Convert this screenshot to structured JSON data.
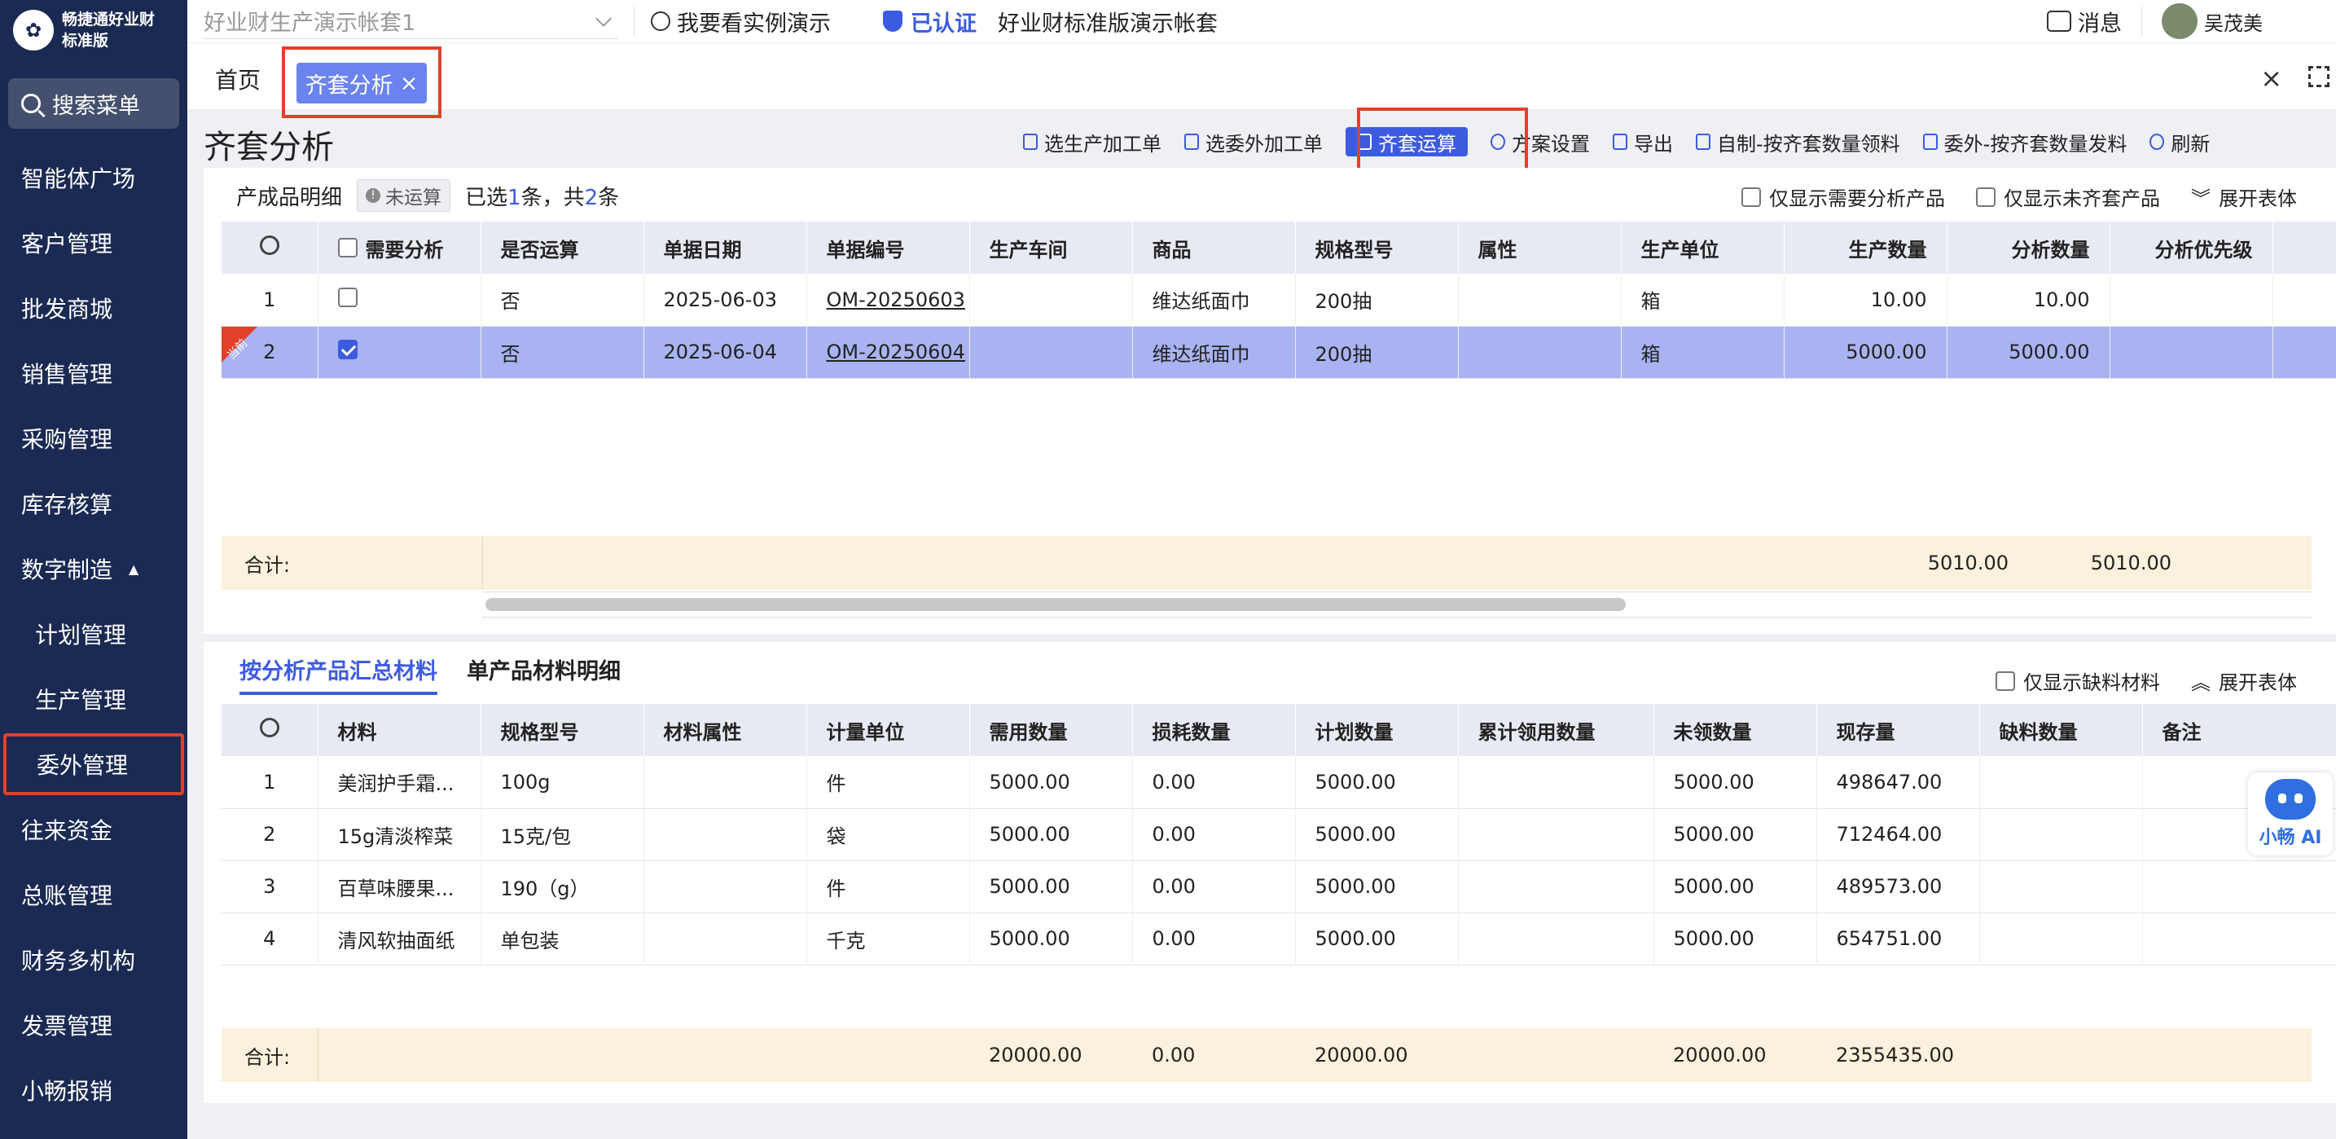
{
  "sidebar": {
    "logo_text_line1": "畅捷通好业财",
    "logo_text_line2": "标准版",
    "search_label": "搜索菜单",
    "items": [
      {
        "label": "智能体广场"
      },
      {
        "label": "客户管理"
      },
      {
        "label": "批发商城"
      },
      {
        "label": "销售管理"
      },
      {
        "label": "采购管理"
      },
      {
        "label": "库存核算"
      },
      {
        "label": "数字制造"
      },
      {
        "label": "计划管理"
      },
      {
        "label": "生产管理"
      },
      {
        "label": "委外管理"
      },
      {
        "label": "往来资金"
      },
      {
        "label": "总账管理"
      },
      {
        "label": "财务多机构"
      },
      {
        "label": "发票管理"
      },
      {
        "label": "小畅报销"
      }
    ]
  },
  "topbar": {
    "account": "好业财生产演示帐套1",
    "demo_link": "我要看实例演示",
    "verified": "已认证",
    "std_account": "好业财标准版演示帐套",
    "messages": "消息",
    "user": "吴茂美"
  },
  "tabs": {
    "home": "首页",
    "active": "齐套分析",
    "active_close": "×",
    "close_all": "×"
  },
  "page": {
    "title": "齐套分析"
  },
  "toolbar": {
    "select_prod": "选生产加工单",
    "select_outsource": "选委外加工单",
    "calc": "齐套运算",
    "scheme": "方案设置",
    "export": "导出",
    "self_issue": "自制-按齐套数量领料",
    "out_issue": "委外-按齐套数量发料",
    "refresh": "刷新"
  },
  "panel1": {
    "title": "产成品明细",
    "status_badge": "未运算",
    "status_badge_icon": "!",
    "sel_prefix": "已选",
    "sel_count": "1",
    "sel_mid": "条，共",
    "sel_total": "2",
    "sel_suffix": "条",
    "only_need": "仅显示需要分析产品",
    "only_incomplete": "仅显示未齐套产品",
    "expand": "展开表体",
    "current_tag": "当前",
    "columns": [
      "需要分析",
      "是否运算",
      "单据日期",
      "单据编号",
      "生产车间",
      "商品",
      "规格型号",
      "属性",
      "生产单位",
      "生产数量",
      "分析数量",
      "分析优先级"
    ],
    "rows": [
      {
        "idx": "1",
        "calc": "否",
        "date": "2025-06-03",
        "code": "OM-20250603",
        "workshop": "",
        "goods": "维达纸面巾",
        "spec": "200抽",
        "attr": "",
        "unit": "箱",
        "qty": "10.00",
        "aqty": "10.00",
        "prio": ""
      },
      {
        "idx": "2",
        "calc": "否",
        "date": "2025-06-04",
        "code": "OM-20250604",
        "workshop": "",
        "goods": "维达纸面巾",
        "spec": "200抽",
        "attr": "",
        "unit": "箱",
        "qty": "5000.00",
        "aqty": "5000.00",
        "prio": ""
      }
    ],
    "sum_label": "合计:",
    "sum_qty": "5010.00",
    "sum_aqty": "5010.00"
  },
  "panel2": {
    "tab_summary": "按分析产品汇总材料",
    "tab_detail": "单产品材料明细",
    "only_short": "仅显示缺料材料",
    "expand": "展开表体",
    "columns": [
      "材料",
      "规格型号",
      "材料属性",
      "计量单位",
      "需用数量",
      "损耗数量",
      "计划数量",
      "累计领用数量",
      "未领数量",
      "现存量",
      "缺料数量",
      "备注"
    ],
    "rows": [
      {
        "idx": "1",
        "mat": "美润护手霜...",
        "spec": "100g",
        "attr": "",
        "unit": "件",
        "need": "5000.00",
        "loss": "0.00",
        "plan": "5000.00",
        "cum": "",
        "unrec": "5000.00",
        "stock": "498647.00",
        "short": "",
        "note": ""
      },
      {
        "idx": "2",
        "mat": "15g清淡榨菜",
        "spec": "15克/包",
        "attr": "",
        "unit": "袋",
        "need": "5000.00",
        "loss": "0.00",
        "plan": "5000.00",
        "cum": "",
        "unrec": "5000.00",
        "stock": "712464.00",
        "short": "",
        "note": ""
      },
      {
        "idx": "3",
        "mat": "百草味腰果...",
        "spec": "190（g）",
        "attr": "",
        "unit": "件",
        "need": "5000.00",
        "loss": "0.00",
        "plan": "5000.00",
        "cum": "",
        "unrec": "5000.00",
        "stock": "489573.00",
        "short": "",
        "note": ""
      },
      {
        "idx": "4",
        "mat": "清风软抽面纸",
        "spec": "单包装",
        "attr": "",
        "unit": "千克",
        "need": "5000.00",
        "loss": "0.00",
        "plan": "5000.00",
        "cum": "",
        "unrec": "5000.00",
        "stock": "654751.00",
        "short": "",
        "note": ""
      }
    ],
    "sum_label": "合计:",
    "sum_need": "20000.00",
    "sum_loss": "0.00",
    "sum_plan": "20000.00",
    "sum_unrec": "20000.00",
    "sum_stock": "2355435.00"
  },
  "ai": {
    "label": "小畅 AI"
  }
}
